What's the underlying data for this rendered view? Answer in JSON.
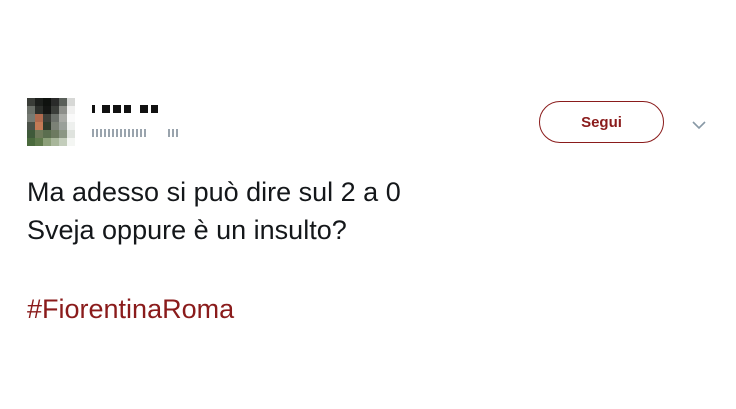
{
  "tweet": {
    "author": {
      "avatar_icon": "user-avatar-pixelated",
      "name_redacted": true,
      "handle_redacted": true
    },
    "follow_label": "Segui",
    "menu_icon": "chevron-down-icon",
    "text_lines": [
      "Ma adesso si può dire sul 2 a 0",
      "Sveja oppure è un insulto?"
    ],
    "hashtag": "#FiorentinaRoma"
  },
  "colors": {
    "accent": "#8a1b1b",
    "text": "#14171a",
    "muted": "#9aa4ad"
  }
}
